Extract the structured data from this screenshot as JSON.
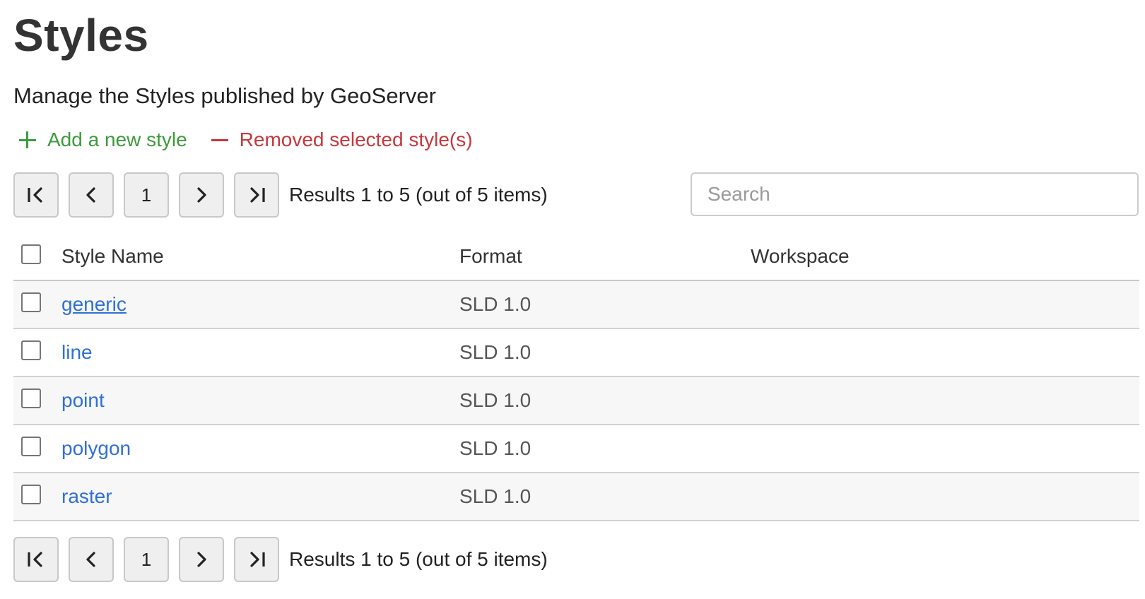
{
  "page": {
    "title": "Styles",
    "subtitle": "Manage the Styles published by GeoServer"
  },
  "actions": {
    "add_label": "Add a new style",
    "add_icon": "plus-icon",
    "remove_label": "Removed selected style(s)",
    "remove_icon": "minus-icon",
    "add_color": "#3c9b3c",
    "remove_color": "#c8373c"
  },
  "pager": {
    "first_icon": "first-page-icon",
    "prev_icon": "chevron-left-icon",
    "current_page": "1",
    "next_icon": "chevron-right-icon",
    "last_icon": "last-page-icon",
    "results_text": "Results 1 to 5 (out of 5 items)"
  },
  "search": {
    "placeholder": "Search",
    "value": ""
  },
  "table": {
    "headers": {
      "name": "Style Name",
      "format": "Format",
      "workspace": "Workspace"
    },
    "rows": [
      {
        "name": "generic",
        "format": "SLD 1.0",
        "workspace": "",
        "checked": false
      },
      {
        "name": "line",
        "format": "SLD 1.0",
        "workspace": "",
        "checked": false
      },
      {
        "name": "point",
        "format": "SLD 1.0",
        "workspace": "",
        "checked": false
      },
      {
        "name": "polygon",
        "format": "SLD 1.0",
        "workspace": "",
        "checked": false
      },
      {
        "name": "raster",
        "format": "SLD 1.0",
        "workspace": "",
        "checked": false
      }
    ]
  },
  "colors": {
    "link": "#2f6fd6",
    "row_alt": "#f7f7f7"
  }
}
